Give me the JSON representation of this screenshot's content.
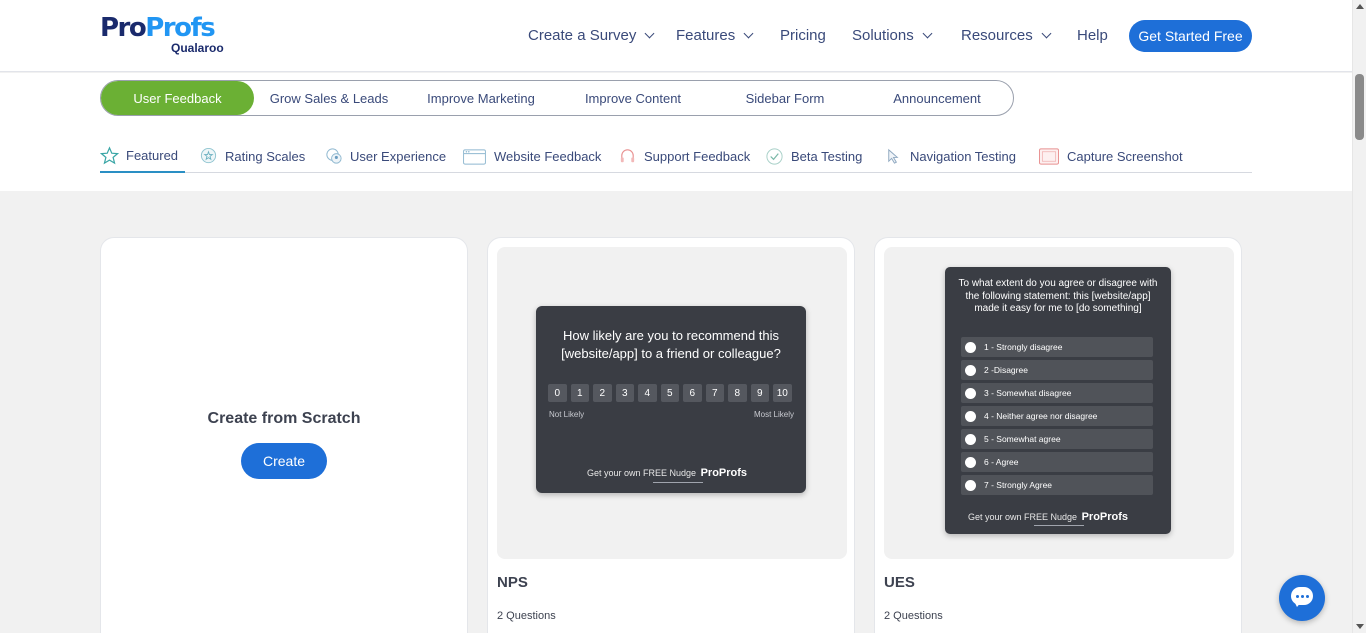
{
  "header": {
    "logo_main_a": "Pro",
    "logo_main_b": "Profs",
    "logo_sub": "Qualaroo",
    "nav": [
      {
        "label": "Create a Survey",
        "icon": "chevron-down-icon"
      },
      {
        "label": "Features",
        "icon": "chevron-down-icon"
      },
      {
        "label": "Pricing"
      },
      {
        "label": "Solutions",
        "icon": "chevron-down-icon"
      },
      {
        "label": "Resources",
        "icon": "chevron-down-icon"
      },
      {
        "label": "Help"
      }
    ],
    "cta": "Get Started Free"
  },
  "categories": [
    {
      "label": "User Feedback",
      "active": true
    },
    {
      "label": "Grow Sales & Leads"
    },
    {
      "label": "Improve Marketing"
    },
    {
      "label": "Improve Content"
    },
    {
      "label": "Sidebar Form"
    },
    {
      "label": "Announcement"
    }
  ],
  "tabs": [
    {
      "label": "Featured",
      "icon": "star-icon",
      "active": true
    },
    {
      "label": "Rating Scales",
      "icon": "rating-bubble-icon"
    },
    {
      "label": "User Experience",
      "icon": "users-icon"
    },
    {
      "label": "Website Feedback",
      "icon": "browser-window-icon"
    },
    {
      "label": "Support Feedback",
      "icon": "headset-icon"
    },
    {
      "label": "Beta Testing",
      "icon": "check-circle-icon"
    },
    {
      "label": "Navigation Testing",
      "icon": "pointer-icon"
    },
    {
      "label": "Capture Screenshot",
      "icon": "screenshot-frame-icon"
    }
  ],
  "cards": {
    "scratch": {
      "title": "Create from Scratch",
      "button": "Create"
    },
    "nps": {
      "title": "NPS",
      "subtitle": "2 Questions",
      "question": "How likely are you to recommend this [website/app] to a friend or colleague?",
      "scale": [
        "0",
        "1",
        "2",
        "3",
        "4",
        "5",
        "6",
        "7",
        "8",
        "9",
        "10"
      ],
      "low_label": "Not Likely",
      "high_label": "Most Likely",
      "nudge_text": "Get your own FREE Nudge",
      "nudge_brand": "ProProfs"
    },
    "ues": {
      "title": "UES",
      "subtitle": "2 Questions",
      "question": "To what extent do you agree or disagree with the following statement: this [website/app] made it easy for me to [do something]",
      "options": [
        "1 - Strongly disagree",
        "2 -Disagree",
        "3 - Somewhat disagree",
        "4 - Neither agree nor disagree",
        "5 - Somewhat agree",
        "6 - Agree",
        "7 - Strongly Agree"
      ],
      "nudge_text": "Get your own FREE Nudge",
      "nudge_brand": "ProProfs"
    }
  },
  "colors": {
    "accent_blue": "#1e6fd8",
    "active_green": "#6bb034",
    "widget_dark": "#3a3d44"
  },
  "chat_icon": "chat-bubble-icon"
}
